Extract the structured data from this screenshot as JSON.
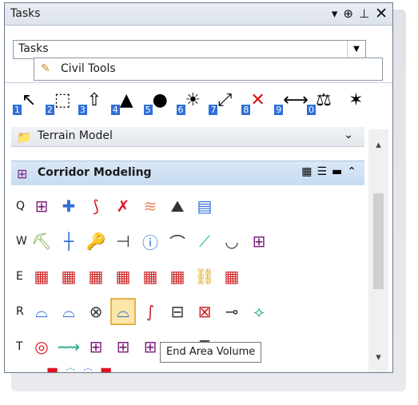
{
  "window": {
    "title": "Tasks"
  },
  "titlebar": {
    "icons": [
      "dropdown-icon",
      "pin-icon",
      "autohide-icon",
      "close-icon"
    ]
  },
  "tasks_combo": {
    "value": "Tasks"
  },
  "civil_tools": {
    "label": "Civil Tools"
  },
  "main_tools": [
    {
      "icon": "select-arrow-icon",
      "num": "1"
    },
    {
      "icon": "selection-box-icon",
      "num": "2"
    },
    {
      "icon": "place-element-icon",
      "num": "3"
    },
    {
      "icon": "paint-icon",
      "num": "4"
    },
    {
      "icon": "palette-icon",
      "num": "5"
    },
    {
      "icon": "bulb-icon",
      "num": "6"
    },
    {
      "icon": "fit-view-icon",
      "num": "7"
    },
    {
      "icon": "delete-icon",
      "num": "8"
    },
    {
      "icon": "measure-icon",
      "num": "9"
    },
    {
      "icon": "scale-icon",
      "num": "0"
    },
    {
      "icon": "star-icon",
      "num": ""
    }
  ],
  "terrain_model": {
    "label": "Terrain Model"
  },
  "corridor_modeling": {
    "label": "Corridor Modeling"
  },
  "rows": [
    {
      "key": "Q",
      "tools": [
        "corridor-icon",
        "template-icon",
        "curve-icon",
        "cross-icon",
        "surface-icon",
        "hill-icon",
        "profile-icon"
      ]
    },
    {
      "key": "W",
      "tools": [
        "excavator-icon",
        "line-icon",
        "key-icon",
        "split-icon",
        "info-icon",
        "arc-icon",
        "transition-icon",
        "bowl-icon",
        "corridor2-icon"
      ]
    },
    {
      "key": "E",
      "tools": [
        "grid-icon",
        "grid-edit-icon",
        "grid-move-icon",
        "grid-pi-icon",
        "grid-plus-icon",
        "grid-curve-icon",
        "grid-link-icon",
        "grid-small-icon"
      ]
    },
    {
      "key": "R",
      "tools": [
        "section-icon",
        "section2-icon",
        "section-x-icon",
        "end-area-volume-icon",
        "curve2-icon",
        "boundary-icon",
        "boundary-x-icon",
        "section-edit-icon",
        "split2-icon"
      ]
    },
    {
      "key": "T",
      "tools": [
        "target-icon",
        "bridge-icon",
        "corridor-plus-icon",
        "corridor-x-icon",
        "corridor-plus2-icon",
        "corridor-minus-icon",
        "text-icon",
        "corridor-down-icon"
      ]
    }
  ],
  "tooltip": {
    "text": "End Area Volume"
  }
}
